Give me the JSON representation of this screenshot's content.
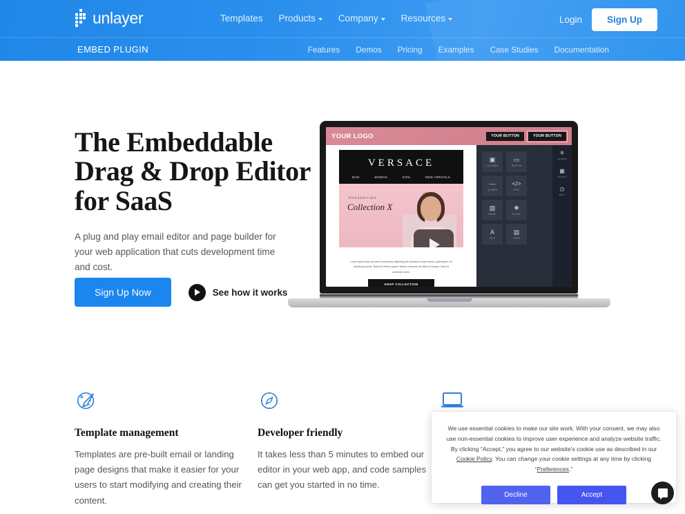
{
  "header": {
    "brand": "unlayer",
    "logo_icon": "unlayer-squares-logo",
    "nav": [
      {
        "label": "Templates",
        "has_caret": false
      },
      {
        "label": "Products",
        "has_caret": true
      },
      {
        "label": "Company",
        "has_caret": true
      },
      {
        "label": "Resources",
        "has_caret": true
      }
    ],
    "login_label": "Login",
    "signup_label": "Sign Up",
    "subbar_title": "EMBED PLUGIN",
    "subnav": [
      {
        "label": "Features"
      },
      {
        "label": "Demos"
      },
      {
        "label": "Pricing"
      },
      {
        "label": "Examples"
      },
      {
        "label": "Case Studies"
      },
      {
        "label": "Documentation"
      }
    ],
    "colors": {
      "bg_start": "#1f87e8",
      "bg_end": "#2e93ee",
      "signup_text": "#1e7fd4"
    }
  },
  "hero": {
    "title": "The Embeddable Drag & Drop Editor for SaaS",
    "subtitle": "A plug and play email editor and page builder for your web application that cuts development time and cost.",
    "primary_cta": "Sign Up Now",
    "secondary_cta": "See how it works",
    "primary_cta_color": "#1a86ee"
  },
  "laptop_mockup": {
    "editor": {
      "logo_placeholder": "YOUR LOGO",
      "buttons": [
        "YOUR BUTTON",
        "YOUR BUTTON"
      ],
      "email": {
        "brand": "VERSACE",
        "nav": [
          "MAN",
          "WOMAN",
          "KIDS",
          "NEW ARRIVALS"
        ],
        "presenting_label": "PRESENTING",
        "collection_title": "Collection X",
        "body_text": "Lorem ipsum dolor sit amet, consectetur adipiscing elit. Aenean in turpis varius, porta ipsum vel ullamcorper justo. Nulla vel finibus sapien. Mauris commodo vel felis mi rhoncus. Nunc id commodo lorem.",
        "cta": "SHOP COLLECTION"
      },
      "tools": [
        {
          "label": "COLUMNS",
          "icon": "columns-icon",
          "glyph": "▣"
        },
        {
          "label": "BUTTON",
          "icon": "button-icon",
          "glyph": "▭"
        },
        {
          "label": "DIVIDER",
          "icon": "divider-icon",
          "glyph": "—"
        },
        {
          "label": "HTML",
          "icon": "code-icon",
          "glyph": "</>"
        },
        {
          "label": "IMAGE",
          "icon": "image-icon",
          "glyph": "▨"
        },
        {
          "label": "SOCIAL",
          "icon": "social-icon",
          "glyph": "❖"
        },
        {
          "label": "TEXT",
          "icon": "text-icon",
          "glyph": "A"
        },
        {
          "label": "VIDEO",
          "icon": "video-icon",
          "glyph": "▤"
        }
      ],
      "rail": [
        {
          "label": "CONTENT",
          "icon": "content-icon",
          "glyph": "⚛",
          "active": true
        },
        {
          "label": "BLOCKS",
          "icon": "blocks-icon",
          "glyph": "▦",
          "active": false
        },
        {
          "label": "BODY",
          "icon": "body-icon",
          "glyph": "◷",
          "active": false
        }
      ]
    }
  },
  "features": [
    {
      "icon": "palette-brush-icon",
      "title": "Template management",
      "description": "Templates are pre-built email or landing page designs that make it easier for your users to start modifying and creating their content."
    },
    {
      "icon": "compass-icon",
      "title": "Developer friendly",
      "description": "It takes less than 5 minutes to embed our editor in your web app, and code samples can get you started in no time."
    },
    {
      "icon": "laptop-icon",
      "title": "",
      "description": ""
    }
  ],
  "cookie_banner": {
    "text_part1": "We use essential cookies to make our site work. With your consent, we may also use non-essential cookies to improve user experience and analyze website traffic. By clicking “Accept,” you agree to our website's cookie use as described in our ",
    "link1": "Cookie Policy",
    "text_part2": ". You can change your cookie settings at any time by clicking “",
    "link2": "Preferences",
    "text_part3": ".”",
    "decline_label": "Decline",
    "accept_label": "Accept",
    "button_color": "#4a5ff0"
  },
  "chat_widget": {
    "icon": "chat-bubble-icon",
    "color": "#1d1d1d"
  }
}
